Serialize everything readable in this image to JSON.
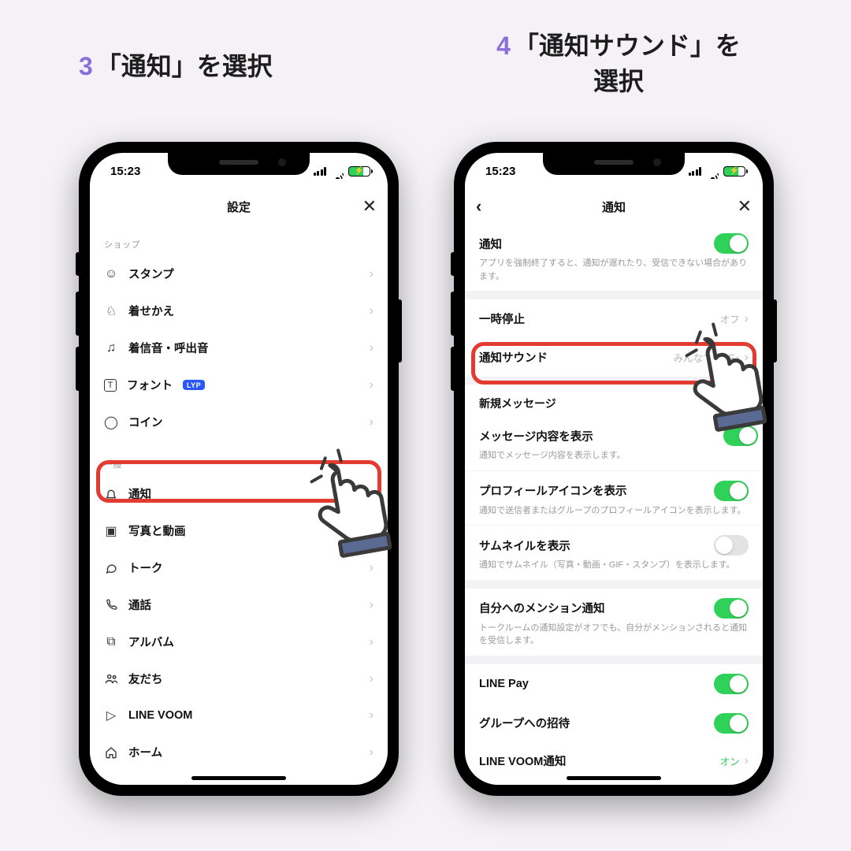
{
  "captions": {
    "step3_num": "3",
    "step3_text": "「通知」を選択",
    "step4_num": "4",
    "step4_text_line1": "「通知サウンド」を",
    "step4_text_line2": "選択"
  },
  "status": {
    "time": "15:23"
  },
  "left": {
    "title": "設定",
    "sections": {
      "shop_label": "ショップ",
      "general_label": "一般"
    },
    "items": {
      "stamp": "スタンプ",
      "theme": "着せかえ",
      "ringtone": "着信音・呼出音",
      "font": "フォント",
      "font_badge": "LYP",
      "coin": "コイン",
      "notify": "通知",
      "photo": "写真と動画",
      "talk": "トーク",
      "call": "通話",
      "album": "アルバム",
      "friends": "友だち",
      "voom": "LINE VOOM",
      "home": "ホーム"
    }
  },
  "right": {
    "title": "通知",
    "notify_title": "通知",
    "notify_desc": "アプリを強制終了すると、通知が遅れたり、受信できない場合があります。",
    "pause_title": "一時停止",
    "pause_value": "オフ",
    "sound_title": "通知サウンド",
    "sound_value": "みんなでLINE♪",
    "newmsg_header": "新規メッセージ",
    "msg_content_title": "メッセージ内容を表示",
    "msg_content_desc": "通知でメッセージ内容を表示します。",
    "profile_icon_title": "プロフィールアイコンを表示",
    "profile_icon_desc": "通知で送信者またはグループのプロフィールアイコンを表示します。",
    "thumbnail_title": "サムネイルを表示",
    "thumbnail_desc": "通知でサムネイル（写真・動画・GIF・スタンプ）を表示します。",
    "mention_title": "自分へのメンション通知",
    "mention_desc": "トークルームの通知設定がオフでも、自分がメンションされると通知を受信します。",
    "linepay_title": "LINE Pay",
    "group_invite_title": "グループへの招待",
    "voom_notify_title": "LINE VOOM通知",
    "voom_notify_value": "オン"
  }
}
